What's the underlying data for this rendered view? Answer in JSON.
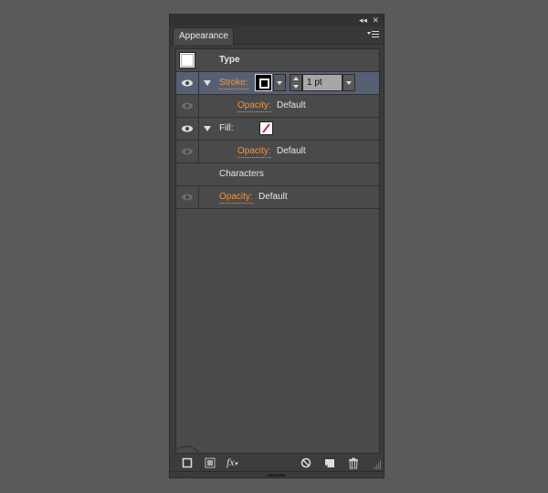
{
  "window": {
    "collapse_icon": "double-left-arrow-icon",
    "close_icon": "close-icon",
    "collapse_glyph": "◂◂",
    "close_glyph": "✕"
  },
  "tab": {
    "label": "Appearance",
    "menu_icon": "panel-menu-icon"
  },
  "header": {
    "label": "Type"
  },
  "rows": {
    "stroke": {
      "label": "Stroke:",
      "weight_value": "1 pt",
      "swatch_color": "#000000"
    },
    "stroke_opacity": {
      "label": "Opacity:",
      "value": "Default"
    },
    "fill": {
      "label": "Fill:",
      "swatch": "none"
    },
    "fill_opacity": {
      "label": "Opacity:",
      "value": "Default"
    },
    "characters": {
      "label": "Characters"
    },
    "opacity": {
      "label": "Opacity:",
      "value": "Default"
    }
  },
  "bottom_toolbar": {
    "items": [
      "add-new-stroke-icon",
      "add-new-fill-icon",
      "add-new-effect-icon",
      "clear-appearance-icon",
      "duplicate-item-icon",
      "delete-item-icon"
    ],
    "fx_label": "fx"
  },
  "colors": {
    "accent_orange": "#f0963c",
    "selected_row": "#566074",
    "panel_bg": "#4a4a4a",
    "none_slash": "#d0284a"
  }
}
